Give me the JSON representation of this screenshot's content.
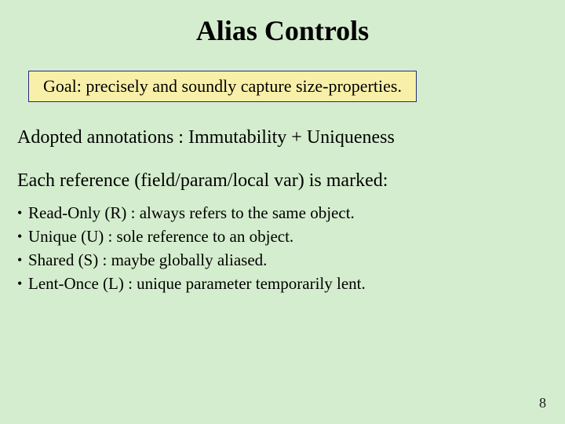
{
  "title": "Alias Controls",
  "goal": "Goal: precisely and soundly capture size-properties.",
  "line_adopted": "Adopted annotations : Immutability + Uniqueness",
  "line_each": "Each reference (field/param/local var) is marked:",
  "bullets": [
    "Read-Only (R) : always refers to the same object.",
    "Unique (U) : sole reference to an object.",
    "Shared (S) : maybe globally aliased.",
    "Lent-Once (L) : unique parameter temporarily lent."
  ],
  "page_number": "8"
}
